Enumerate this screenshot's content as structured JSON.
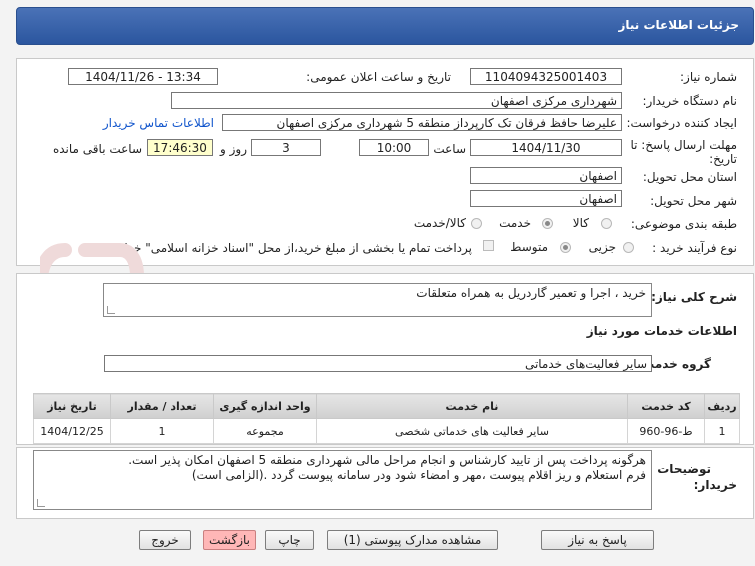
{
  "header": {
    "title": "جزئیات اطلاعات نیاز"
  },
  "form": {
    "need_number": {
      "label": "شماره نیاز:",
      "value": "1104094325001403"
    },
    "announce": {
      "label": "تاریخ و ساعت اعلان عمومی:",
      "value": "1404/11/26 - 13:34"
    },
    "buyer_org": {
      "label": "نام دستگاه خریدار:",
      "value": "شهرداری مرکزی اصفهان"
    },
    "creator": {
      "label": "ایجاد کننده درخواست:",
      "value": "علیرضا حافظ فرقان تک کارپرداز منطقه 5 شهرداری مرکزی اصفهان",
      "contact_link": "اطلاعات تماس خریدار"
    },
    "deadline": {
      "label_line1": "مهلت ارسال پاسخ: تا",
      "label_line2": "تاریخ:",
      "date": "1404/11/30",
      "time_label": "ساعت",
      "time": "10:00",
      "days": "3",
      "days_label": "روز و",
      "remaining": "17:46:30",
      "remaining_label": "ساعت باقی مانده"
    },
    "province": {
      "label": "استان محل تحویل:",
      "value": "اصفهان"
    },
    "city": {
      "label": "شهر محل تحویل:",
      "value": "اصفهان"
    },
    "category": {
      "label": "طبقه بندی موضوعی:",
      "options": [
        "کالا",
        "خدمت",
        "کالا/خدمت"
      ],
      "selected": "خدمت"
    },
    "process": {
      "label": "نوع فرآیند خرید :",
      "options": [
        "جزیی",
        "متوسط"
      ],
      "selected": "متوسط",
      "treasury_note": "پرداخت تمام یا بخشی از مبلغ خرید،از محل \"اسناد خزانه اسلامی\" خواهد بود."
    }
  },
  "description": {
    "label": "شرح کلی نیاز:",
    "value": "خرید ، اجرا و تعمیر گاردریل به همراه متعلقات"
  },
  "services": {
    "section_title": "اطلاعات خدمات مورد نیاز",
    "group_label": "گروه خدمت:",
    "group_value": "سایر فعالیت‌های خدماتی",
    "columns": [
      "ردیف",
      "کد خدمت",
      "نام خدمت",
      "واحد اندازه گیری",
      "تعداد / مقدار",
      "تاریخ نیاز"
    ],
    "rows": [
      [
        "1",
        "ط-96-960",
        "سایر فعالیت های خدماتی شخصی",
        "مجموعه",
        "1",
        "1404/12/25"
      ]
    ]
  },
  "buyer_notes": {
    "label_line1": "توضیحات",
    "label_line2": "خریدار:",
    "line1": "هرگونه پرداخت پس از تایید کارشناس و انجام مراحل مالی شهرداری منطقه 5 اصفهان  امکان پذیر است.",
    "line2": "فرم استعلام و ریز اقلام پیوست ،مهر و امضاء شود ودر سامانه پیوست گردد .(الزامی است)"
  },
  "buttons": {
    "reply": "پاسخ به نیاز",
    "attachments": "مشاهده مدارک پیوستی (1)",
    "print": "چاپ",
    "back": "بازگشت",
    "exit": "خروج"
  },
  "watermark": {
    "text": "AriaTender.net"
  },
  "colors": {
    "header": "#2b569f",
    "link": "#1155cc",
    "highlight": "#ffffcc",
    "pink_button": "#ffb7b7"
  }
}
